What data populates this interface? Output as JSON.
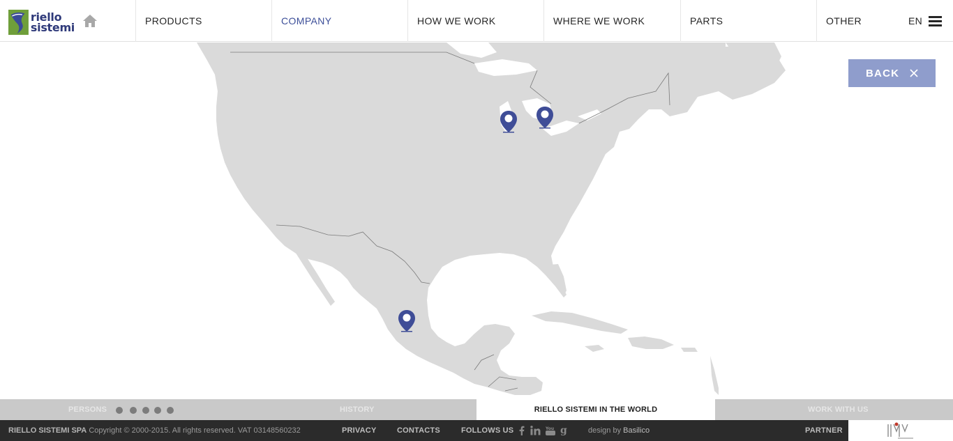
{
  "brand": {
    "line1": "riello",
    "line2": "sistemi",
    "green": "#6f9e3a",
    "blue": "#3a4a99"
  },
  "header": {
    "home_icon": "home-icon",
    "nav": [
      {
        "label": "PRODUCTS",
        "active": false
      },
      {
        "label": "COMPANY",
        "active": true
      },
      {
        "label": "HOW WE WORK",
        "active": false
      },
      {
        "label": "WHERE WE WORK",
        "active": false
      },
      {
        "label": "PARTS",
        "active": false
      },
      {
        "label": "OTHER",
        "active": false
      }
    ],
    "lang": "EN",
    "menu_icon": "hamburger-icon"
  },
  "map": {
    "land_color": "#dadada",
    "pin_color": "#3f4d97",
    "pins": [
      "map-pin",
      "map-pin",
      "map-pin"
    ]
  },
  "back_button": {
    "label": "BACK",
    "icon": "close-icon",
    "bg": "#8f9dcc"
  },
  "tabs": {
    "persons": "PERSONS",
    "history": "HISTORY",
    "world": "RIELLO SISTEMI IN THE WORLD",
    "work": "WORK WITH US",
    "dots": 5
  },
  "footer": {
    "company": "RIELLO SISTEMI SPA",
    "copyright": "Copyright © 2000-2015. All rights reserved. VAT 03148560232",
    "privacy": "PRIVACY",
    "contacts": "CONTACTS",
    "follow": "FOLLOWS US",
    "social": [
      "facebook-icon",
      "linkedin-icon",
      "youtube-icon",
      "google-plus-icon"
    ],
    "design_prefix": "design by",
    "designer": "Basilico",
    "partner": "PARTNER"
  }
}
